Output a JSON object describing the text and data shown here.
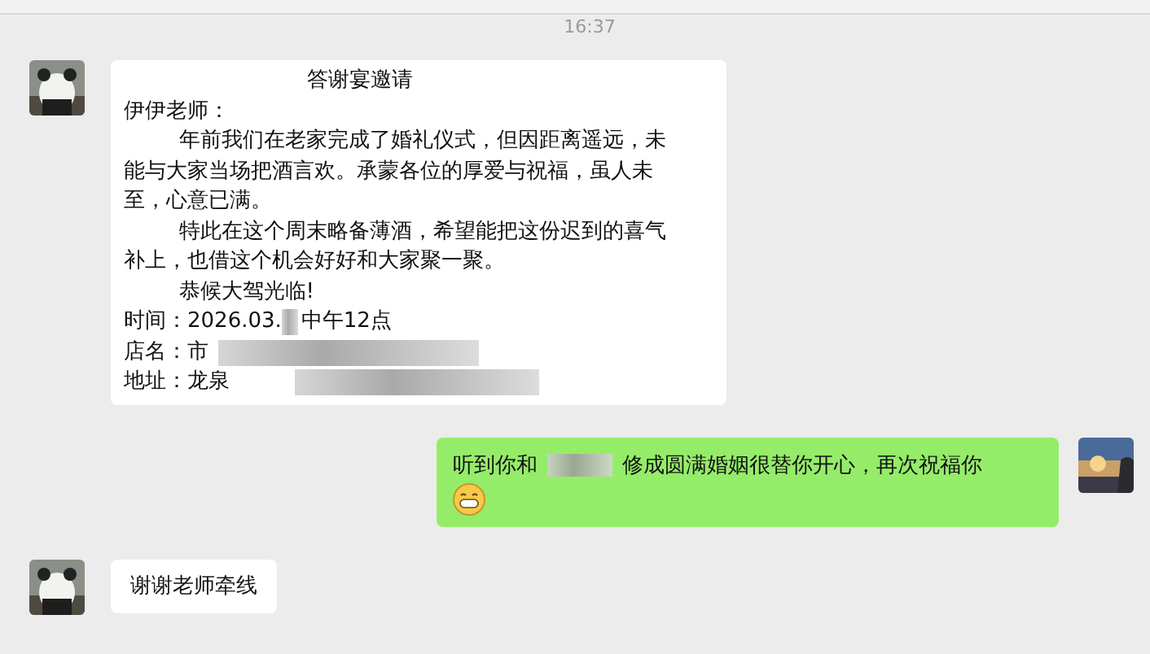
{
  "timestamp": "16:37",
  "messages": [
    {
      "kind": "letter",
      "title": "答谢宴邀请",
      "greeting": "伊伊老师：",
      "paragraphs": [
        "年前我们在老家完成了婚礼仪式，但因距离遥远，未能与大家当场把酒言欢。承蒙各位的厚爱与祝福，虽人未至，心意已满。",
        "特此在这个周末略备薄酒，希望能把这份迟到的喜气补上，也借这个机会好好和大家聚一聚。",
        "恭候大驾光临!"
      ],
      "fields": [
        {
          "label": "时间：",
          "value": "2026.03.",
          "value_2": "中午12点"
        },
        {
          "label": "店名：",
          "value": "市"
        },
        {
          "label": "地址：",
          "value": "龙泉"
        }
      ]
    },
    {
      "kind": "sent",
      "parts": [
        "听到你和",
        "修成圆满婚姻很替你开心，再次祝福你"
      ],
      "emoji": true
    },
    {
      "kind": "received",
      "parts": [
        "谢谢老师牵线"
      ],
      "emoji": false
    }
  ]
}
